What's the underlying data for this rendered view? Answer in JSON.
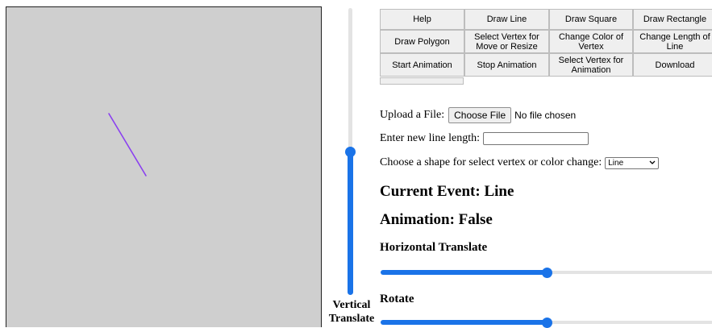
{
  "buttons": {
    "help": "Help",
    "draw_line": "Draw Line",
    "draw_square": "Draw Square",
    "draw_rectangle": "Draw Rectangle",
    "draw_polygon": "Draw Polygon",
    "select_vertex_move": "Select Vertex for Move or Resize",
    "change_color_vertex": "Change Color of Vertex",
    "change_length_line": "Change Length of Line",
    "start_animation": "Start Animation",
    "stop_animation": "Stop Animation",
    "select_vertex_animation": "Select Vertex for Animation",
    "download": "Download"
  },
  "upload": {
    "label": "Upload a File:",
    "button": "Choose File",
    "status": "No file chosen"
  },
  "line_length": {
    "label": "Enter new line length:",
    "value": ""
  },
  "shape_select": {
    "label": "Choose a shape for select vertex or color change:",
    "selected": "Line"
  },
  "current_event": "Current Event: Line",
  "animation_status": "Animation: False",
  "horizontal_translate": {
    "label": "Horizontal Translate",
    "value_fraction": 0.5
  },
  "rotate": {
    "label": "Rotate",
    "value_fraction": 0.5
  },
  "vertical_translate": {
    "label_line1": "Vertical",
    "label_line2": "Translate",
    "value_fraction": 0.5
  },
  "colors": {
    "canvas_bg": "#cfcfcf",
    "line_color": "#8a3ff0",
    "slider_accent": "#1a73e8"
  }
}
